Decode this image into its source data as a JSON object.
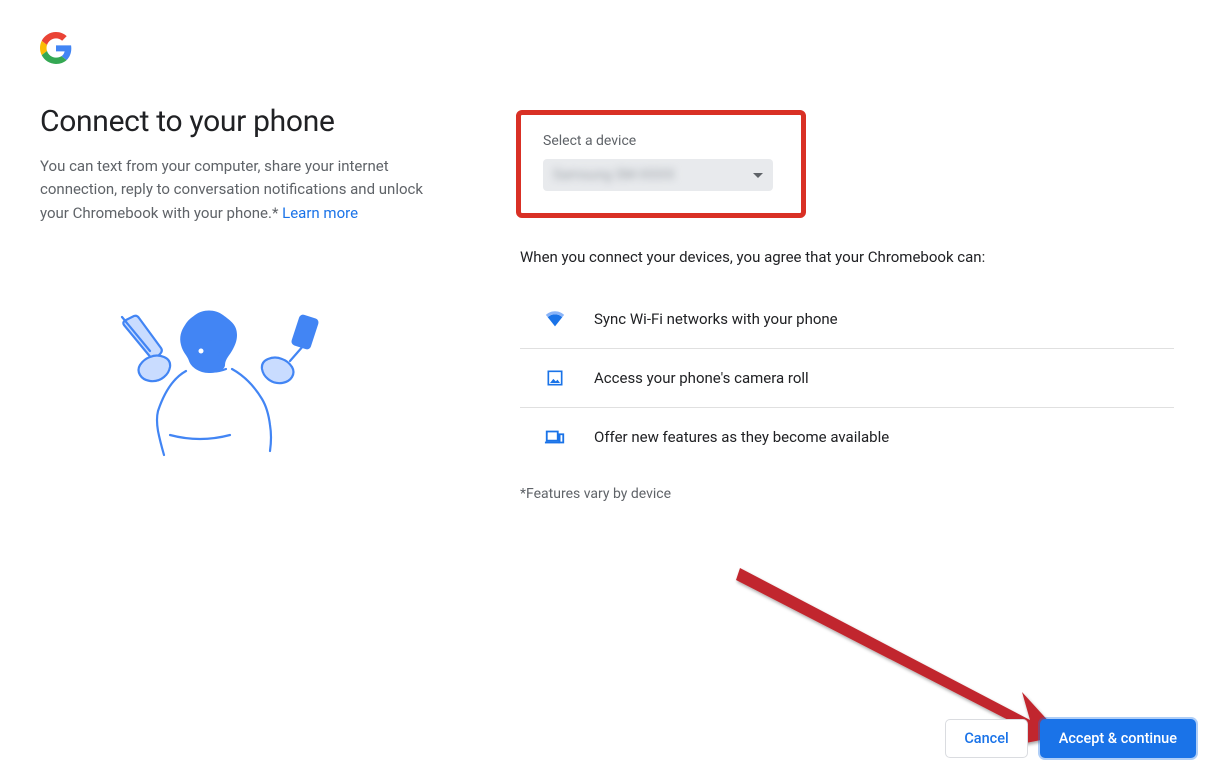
{
  "header": {
    "title": "Connect to your phone",
    "description_prefix": "You can text from your computer, share your internet connection, reply to conversation notifications and unlock your Chromebook with your phone.* ",
    "learn_more": "Learn more"
  },
  "device_select": {
    "label": "Select a device",
    "selected_value": "Samsung SM-XXXX"
  },
  "agreement": {
    "intro": "When you connect your devices, you agree that your Chromebook can:",
    "features": [
      {
        "icon": "wifi-icon",
        "text": "Sync Wi-Fi networks with your phone"
      },
      {
        "icon": "photo-icon",
        "text": "Access your phone's camera roll"
      },
      {
        "icon": "devices-icon",
        "text": "Offer new features as they become available"
      }
    ],
    "footnote": "*Features vary by device"
  },
  "buttons": {
    "cancel": "Cancel",
    "accept": "Accept & continue"
  }
}
